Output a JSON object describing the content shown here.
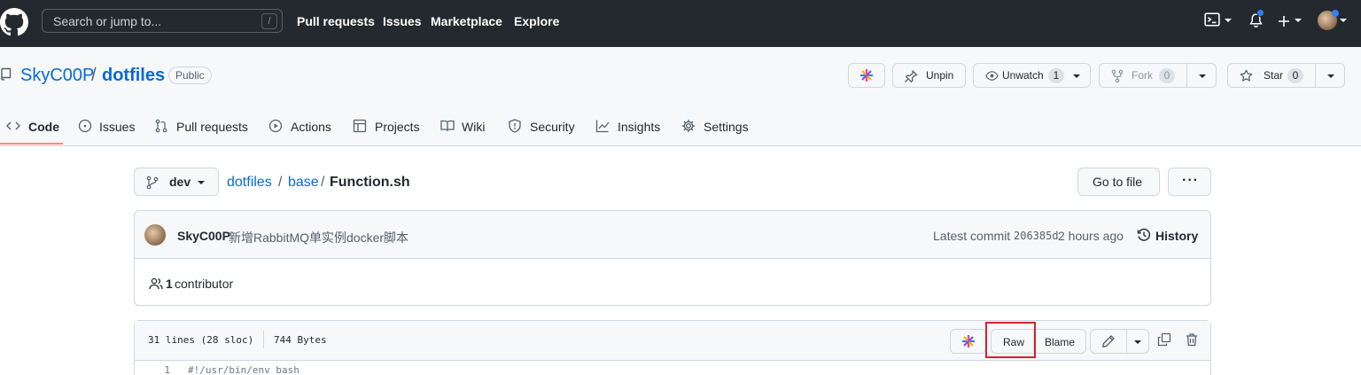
{
  "header": {
    "search_placeholder": "Search or jump to...",
    "search_shortcut": "/",
    "nav": [
      "Pull requests",
      "Issues",
      "Marketplace",
      "Explore"
    ]
  },
  "repo": {
    "owner": "SkyC00P",
    "separator": "/",
    "name": "dotfiles",
    "visibility": "Public",
    "unpin_label": "Unpin",
    "unwatch_label": "Unwatch",
    "watch_count": "1",
    "fork_label": "Fork",
    "fork_count": "0",
    "star_label": "Star",
    "star_count": "0"
  },
  "tabs": [
    {
      "label": "Code",
      "icon": "code-icon"
    },
    {
      "label": "Issues",
      "icon": "issue-icon"
    },
    {
      "label": "Pull requests",
      "icon": "pull-request-icon"
    },
    {
      "label": "Actions",
      "icon": "play-icon"
    },
    {
      "label": "Projects",
      "icon": "table-icon"
    },
    {
      "label": "Wiki",
      "icon": "book-icon"
    },
    {
      "label": "Security",
      "icon": "shield-icon"
    },
    {
      "label": "Insights",
      "icon": "graph-icon"
    },
    {
      "label": "Settings",
      "icon": "gear-icon"
    }
  ],
  "file_nav": {
    "branch": "dev",
    "crumbs": [
      "dotfiles",
      "base"
    ],
    "crumb_sep": "/",
    "filename": "Function.sh",
    "goto_label": "Go to file",
    "more_label": "···"
  },
  "commit": {
    "author": "SkyC00P",
    "message": "新增RabbitMQ单实例docker脚本",
    "latest_label": "Latest commit",
    "sha": "206385d",
    "time": "2 hours ago",
    "history_label": "History",
    "contributors_count": "1",
    "contributors_label": "contributor"
  },
  "file": {
    "lines_info": "31 lines (28 sloc)",
    "size": "744 Bytes",
    "raw_label": "Raw",
    "blame_label": "Blame",
    "code_lines": [
      {
        "num": "1",
        "text": "#!/usr/bin/env bash"
      }
    ]
  },
  "colors": {
    "header_bg": "#24292f",
    "link": "#0969da",
    "tab_underline": "#fd8c73",
    "highlight_box": "#d1242f"
  }
}
